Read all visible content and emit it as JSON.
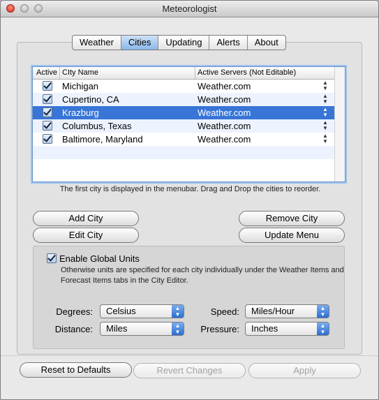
{
  "window": {
    "title": "Meteorologist"
  },
  "tabs": [
    {
      "label": "Weather",
      "selected": false
    },
    {
      "label": "Cities",
      "selected": true
    },
    {
      "label": "Updating",
      "selected": false
    },
    {
      "label": "Alerts",
      "selected": false
    },
    {
      "label": "About",
      "selected": false
    }
  ],
  "table": {
    "headers": {
      "active": "Active",
      "city": "CIty Name",
      "servers": "Active Servers (Not Editable)"
    },
    "rows": [
      {
        "active": true,
        "city": "Michigan",
        "server": "Weather.com",
        "selected": false
      },
      {
        "active": true,
        "city": "Cupertino, CA",
        "server": "Weather.com",
        "selected": false
      },
      {
        "active": true,
        "city": "Krazburg",
        "server": "Weather.com",
        "selected": true
      },
      {
        "active": true,
        "city": "Columbus, Texas",
        "server": "Weather.com",
        "selected": false
      },
      {
        "active": true,
        "city": "Baltimore, Maryland",
        "server": "Weather.com",
        "selected": false
      }
    ]
  },
  "hint": "The first city is displayed in the menubar.  Drag and Drop the cities to reorder.",
  "buttons": {
    "add_city": "Add City",
    "edit_city": "Edit City",
    "remove_city": "Remove City",
    "update_menu": "Update Menu",
    "reset": "Reset to Defaults",
    "revert": "Revert Changes",
    "apply": "Apply"
  },
  "units": {
    "enable_label": "Enable Global Units",
    "enabled": true,
    "description": "Otherwise units are specified for each city individually under the Weather Items and Forecast Items tabs in the City Editor.",
    "degrees": {
      "label": "Degrees:",
      "value": "Celsius"
    },
    "distance": {
      "label": "Distance:",
      "value": "Miles"
    },
    "speed": {
      "label": "Speed:",
      "value": "Miles/Hour"
    },
    "pressure": {
      "label": "Pressure:",
      "value": "Inches"
    }
  },
  "colors": {
    "selection": "#3875d7",
    "alt_row": "#edf3fe",
    "popup_arrows": "#3a7de0"
  }
}
